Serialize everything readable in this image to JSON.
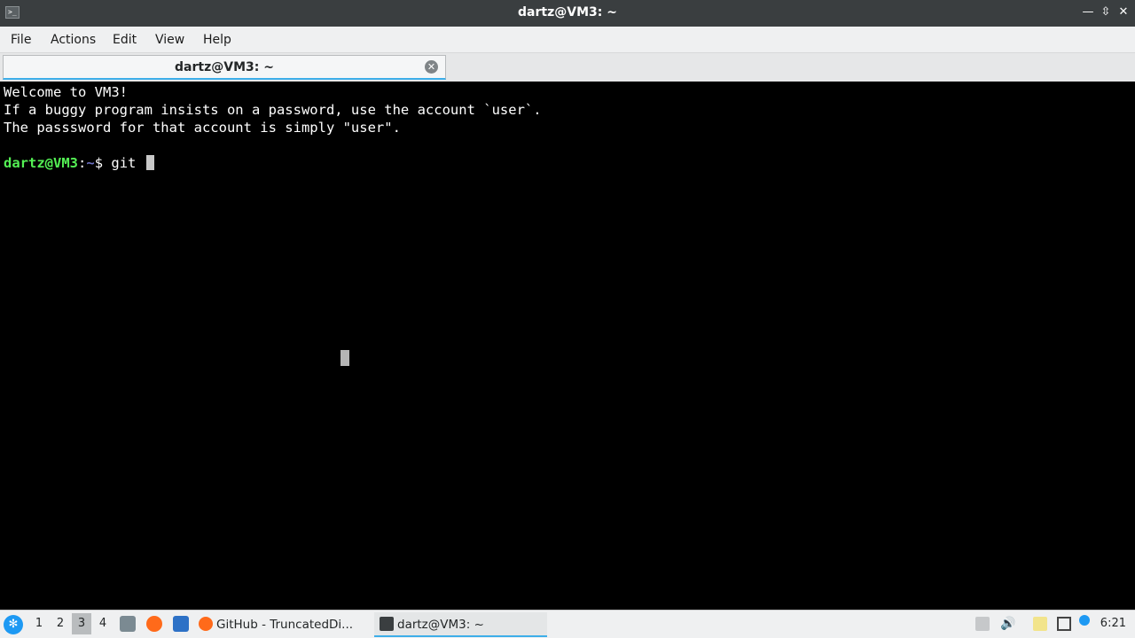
{
  "window": {
    "title": "dartz@VM3: ~",
    "icon": "terminal-icon"
  },
  "menu": {
    "items": [
      "File",
      "Actions",
      "Edit",
      "View",
      "Help"
    ]
  },
  "tab": {
    "title": "dartz@VM3: ~"
  },
  "terminal": {
    "lines": [
      "Welcome to VM3!",
      "If a buggy program insists on a password, use the account `user`.",
      "The passsword for that account is simply \"user\"."
    ],
    "prompt_user": "dartz@VM3",
    "prompt_sep": ":",
    "prompt_path": "~",
    "prompt_symbol": "$ ",
    "command": "git "
  },
  "taskbar": {
    "workspaces": [
      "1",
      "2",
      "3",
      "4"
    ],
    "active_workspace": "3",
    "tasks": [
      {
        "label": "GitHub - TruncatedDi...",
        "icon": "firefox-icon"
      },
      {
        "label": "dartz@VM3: ~",
        "icon": "terminal-icon"
      }
    ],
    "clock": "6:21"
  },
  "colors": {
    "prompt_user": "#54f054",
    "prompt_path": "#6c71c4",
    "accent": "#3daee9"
  }
}
